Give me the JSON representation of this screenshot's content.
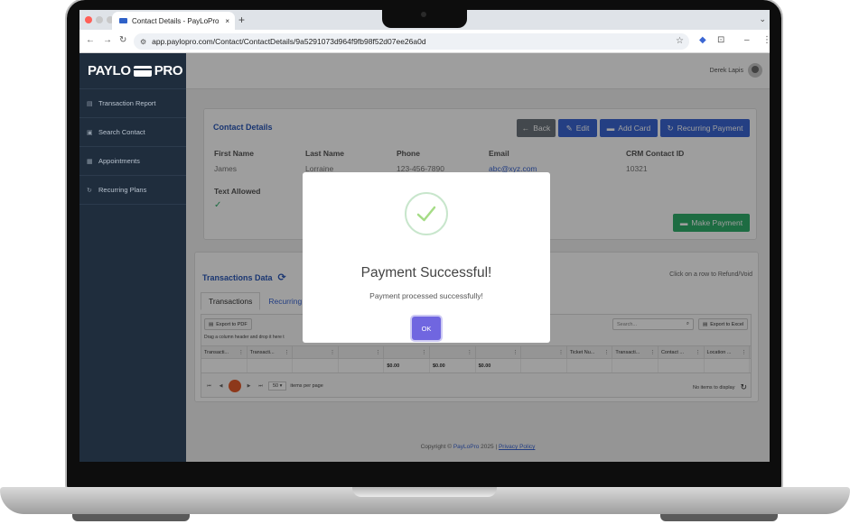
{
  "browser": {
    "tab_title": "Contact Details - PayLoPro",
    "tab_close": "×",
    "new_tab": "+",
    "url": "app.paylopro.com/Contact/ContactDetails/9a5291073d964f9fb98f52d07ee26a0d"
  },
  "sidebar": {
    "logo_left": "PAYLO",
    "logo_right": "PRO",
    "items": [
      {
        "label": "Transaction Report"
      },
      {
        "label": "Search Contact"
      },
      {
        "label": "Appointments"
      },
      {
        "label": "Recurring Plans"
      }
    ]
  },
  "topbar": {
    "user_name": "Derek Lapis"
  },
  "contact": {
    "title": "Contact Details",
    "buttons": {
      "back": "Back",
      "edit": "Edit",
      "add_card": "Add Card",
      "recurring": "Recurring Payment",
      "make_payment": "Make Payment"
    },
    "fields": [
      {
        "label": "First Name",
        "value": "James"
      },
      {
        "label": "Last Name",
        "value": "Lorraine"
      },
      {
        "label": "Phone",
        "value": "123-456-7890"
      },
      {
        "label": "Email",
        "value": "abc@xyz.com"
      },
      {
        "label": "CRM Contact ID",
        "value": "10321"
      }
    ],
    "text_allowed_label": "Text Allowed"
  },
  "transactions": {
    "title": "Transactions Data",
    "hint": "Click on a row to Refund/Void",
    "tabs": [
      "Transactions",
      "Recurring"
    ],
    "export_pdf": "Export to PDF",
    "export_excel": "Export to Excel",
    "search_placeholder": "Search...",
    "drag_hint": "Drag a column header and drop it here t",
    "columns": [
      "Transacti...",
      "Transacti...",
      "",
      "",
      "",
      "",
      "",
      "",
      "Ticket Nu...",
      "Transacti...",
      "Contact ...",
      "Location ..."
    ],
    "summary": [
      "",
      "",
      "",
      "",
      "$0.00",
      "$0.00",
      "$0.00",
      "",
      "",
      "",
      "",
      ""
    ],
    "page_size": "50",
    "items_per_page": "items per page",
    "no_items": "No items to display"
  },
  "footer": {
    "prefix": "Copyright ©",
    "brand": "PayLoPro",
    "year": "2025 |",
    "privacy": "Privacy Policy"
  },
  "modal": {
    "title": "Payment Successful!",
    "text": "Payment processed successfully!",
    "ok": "OK"
  },
  "colors": {
    "sidebar": "#1f2d3d",
    "primary": "#3b66d3",
    "success": "#2fae6b",
    "modal_button": "#7066e0"
  }
}
